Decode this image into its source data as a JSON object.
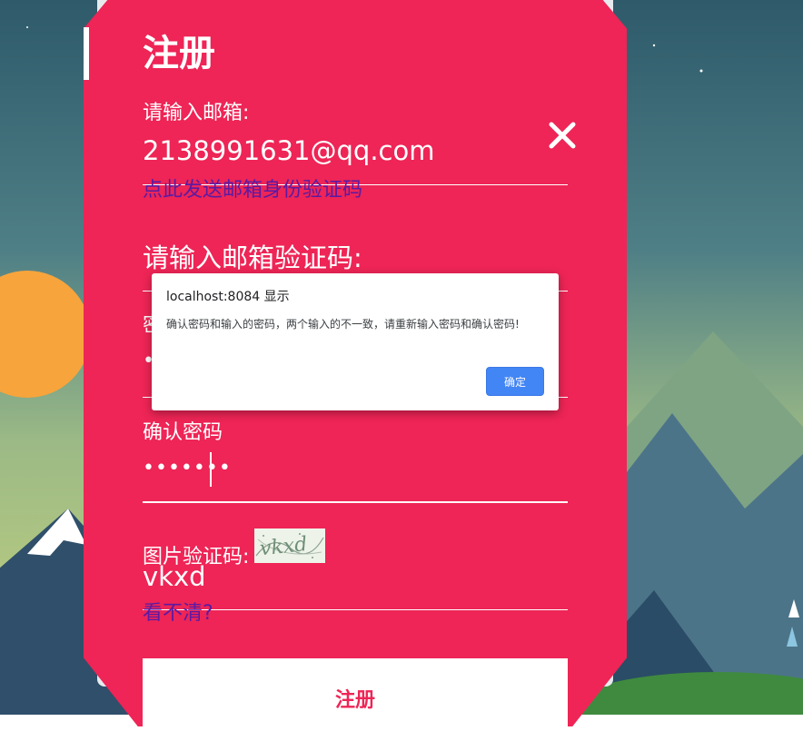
{
  "form": {
    "title": "注册",
    "email": {
      "label": "请输入邮箱:",
      "value": "2138991631@qq.com",
      "send_code_link": "点此发送邮箱身份验证码"
    },
    "email_code": {
      "label": "请输入邮箱验证码:"
    },
    "password": {
      "label_fragment": "密",
      "value_fragment": "•"
    },
    "confirm_password": {
      "label": "确认密码",
      "masked_value": "•••••••"
    },
    "captcha": {
      "label": "图片验证码:",
      "image_text": "vkxd",
      "value": "vkxd",
      "refresh_link": "看不清?"
    },
    "submit_label": "注册"
  },
  "dialog": {
    "title": "localhost:8084 显示",
    "message": "确认密码和输入的密码，两个输入的不一致，请重新输入密码和确认密码!",
    "ok_label": "确定"
  },
  "colors": {
    "form_bg": "#ee2556",
    "link": "#5b1aa3",
    "dialog_button": "#4285f4"
  },
  "icons": {
    "close": "close-icon"
  }
}
